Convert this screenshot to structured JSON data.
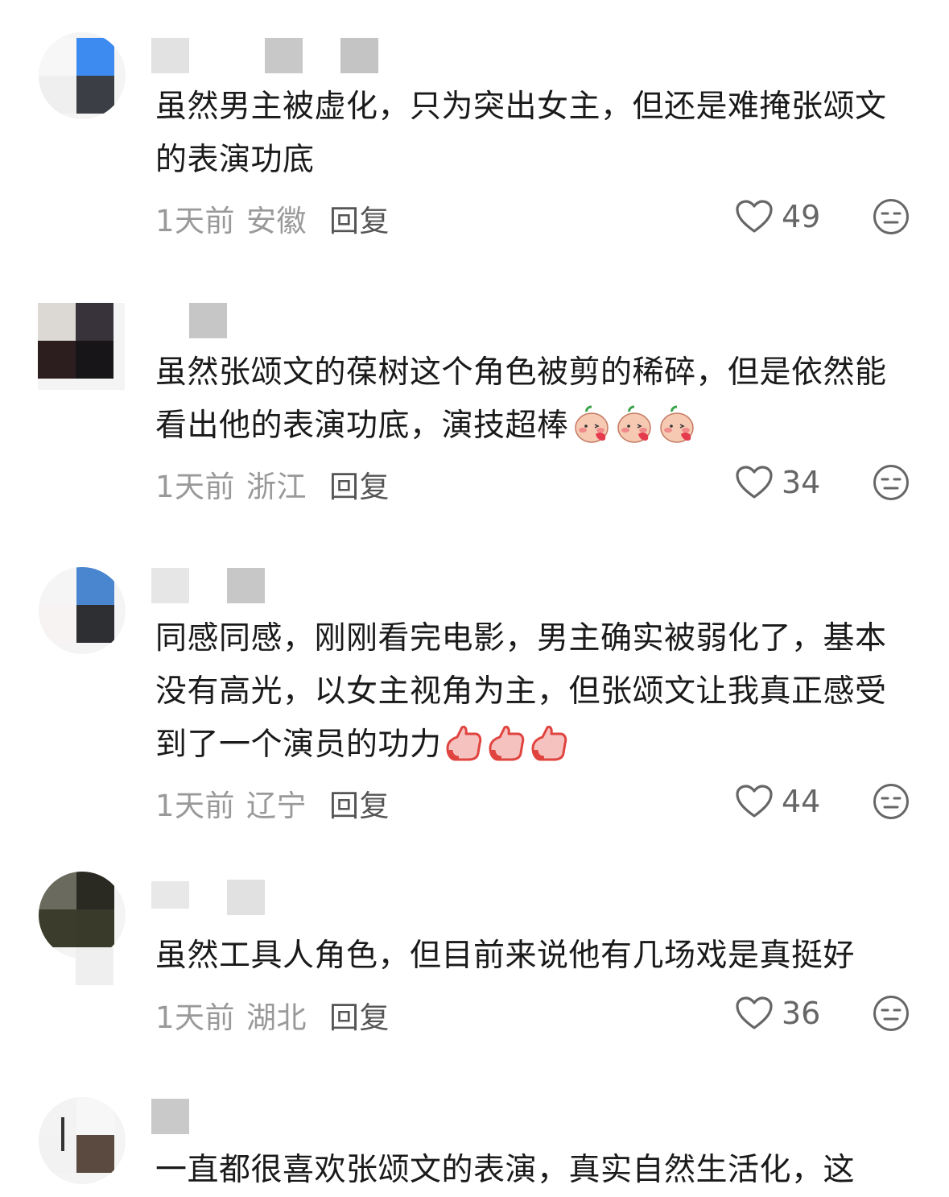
{
  "comments": [
    {
      "text": "虽然男主被虚化，只为突出女主，但还是难掩张颂文的表演功底",
      "time": "1天前",
      "location": "安徽",
      "reply": "回复",
      "likes": "49",
      "emoji_icon": "",
      "emoji_count": 0
    },
    {
      "text": "虽然张颂文的葆树这个角色被剪的稀碎，但是依然能看出他的表演功底，演技超棒",
      "time": "1天前",
      "location": "浙江",
      "reply": "回复",
      "likes": "34",
      "emoji_icon": "blush-emoji-icon",
      "emoji_count": 3
    },
    {
      "text": "同感同感，刚刚看完电影，男主确实被弱化了，基本没有高光，以女主视角为主，但张颂文让我真正感受到了一个演员的功力",
      "time": "1天前",
      "location": "辽宁",
      "reply": "回复",
      "likes": "44",
      "emoji_icon": "thumbs-up-emoji-icon",
      "emoji_count": 3
    },
    {
      "text": "虽然工具人角色，但目前来说他有几场戏是真挺好",
      "time": "1天前",
      "location": "湖北",
      "reply": "回复",
      "likes": "36",
      "emoji_icon": "",
      "emoji_count": 0
    },
    {
      "text": "一直都很喜欢张颂文的表演，真实自然生活化，这",
      "time": "",
      "location": "",
      "reply": "",
      "likes": "",
      "emoji_icon": "",
      "emoji_count": 0
    }
  ],
  "colors": {
    "text": "#1a1a1a",
    "meta": "#999999",
    "reply": "#555555",
    "icon": "#666666"
  }
}
